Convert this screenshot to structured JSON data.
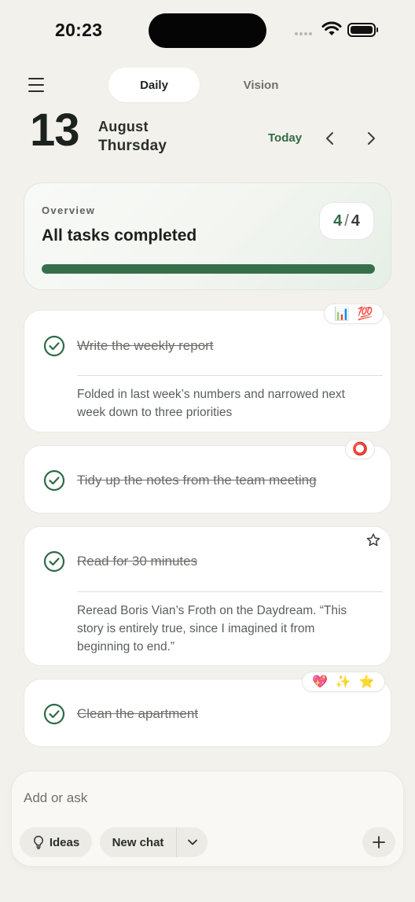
{
  "status_bar": {
    "time": "20:23"
  },
  "header": {
    "tabs": [
      {
        "label": "Daily",
        "active": true
      },
      {
        "label": "Vision",
        "active": false
      }
    ]
  },
  "date": {
    "day": "13",
    "month": "August",
    "weekday": "Thursday",
    "today_label": "Today"
  },
  "overview": {
    "label": "Overview",
    "title": "All tasks completed",
    "completed": "4",
    "separator": "/",
    "total": "4",
    "progress_fraction": 1.0
  },
  "tasks": [
    {
      "title": "Write the weekly report",
      "note": "Folded in last week’s numbers and narrowed next week down to three priorities",
      "tags": [
        "📊",
        "💯"
      ],
      "done": true
    },
    {
      "title": "Tidy up the notes from the team meeting",
      "note": "",
      "tags": [
        "⭕"
      ],
      "done": true
    },
    {
      "title": "Read for 30 minutes",
      "note": "Reread Boris Vian’s Froth on the Daydream. “This story is entirely true, since I imagined it from beginning to end.”",
      "tags": [],
      "favorite_icon": "star-outline-icon",
      "done": true
    },
    {
      "title": "Clean the apartment",
      "note": "",
      "tags": [
        "💖",
        "✨",
        "⭐"
      ],
      "done": true
    }
  ],
  "composer": {
    "placeholder": "Add or ask",
    "ideas_label": "Ideas",
    "new_chat_label": "New chat"
  },
  "colors": {
    "background": "#f3f1ec",
    "accent_green": "#2f6b45",
    "progress_fill": "#35704b"
  }
}
